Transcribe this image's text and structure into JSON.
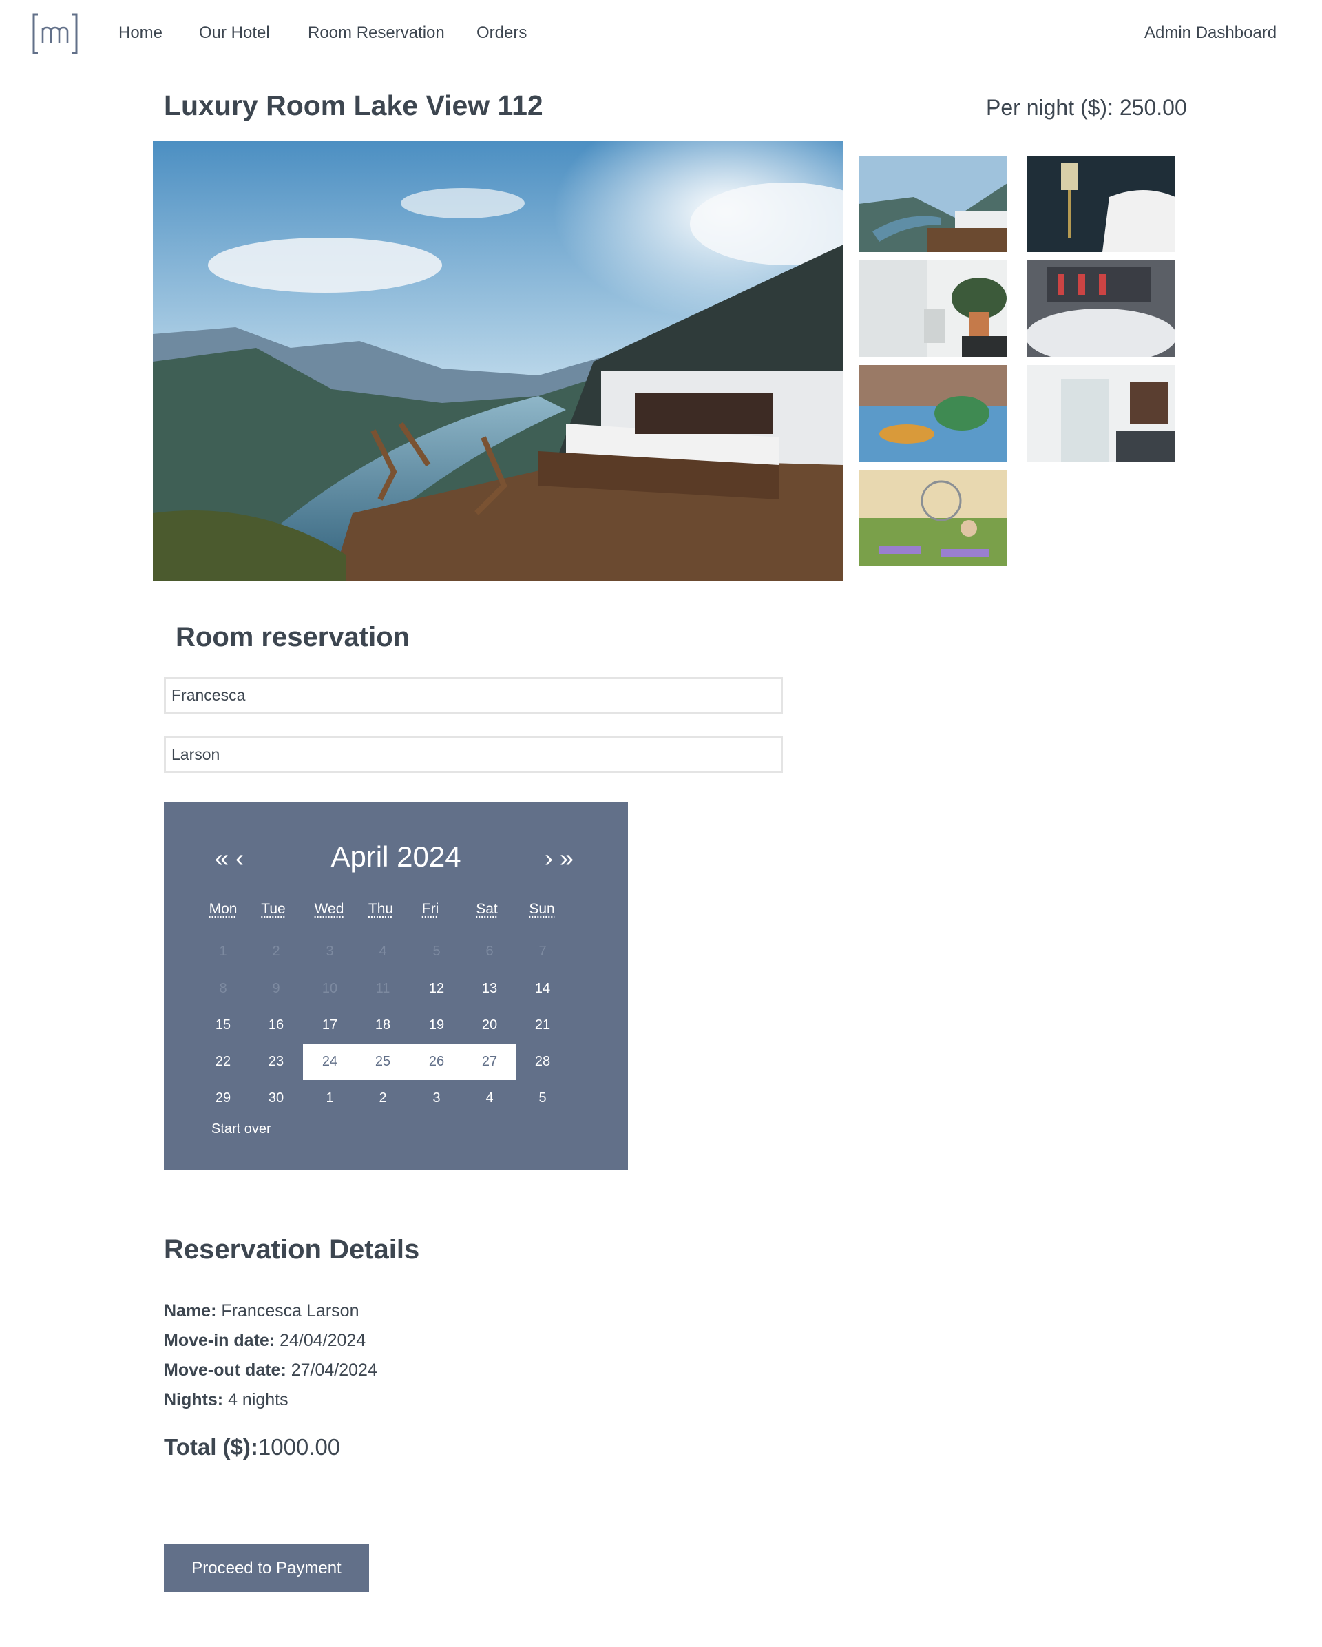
{
  "nav": {
    "logo_alt": "m",
    "home": "Home",
    "hotel": "Our Hotel",
    "reservation": "Room Reservation",
    "orders": "Orders",
    "admin": "Admin Dashboard"
  },
  "room": {
    "title": "Luxury Room Lake View 112",
    "price_label": "Per night ($):",
    "price_value": "250.00"
  },
  "form": {
    "heading": "Room reservation",
    "first_name": "Francesca",
    "last_name": "Larson"
  },
  "calendar": {
    "prev": "« ‹",
    "next": "› »",
    "month": "April 2024",
    "weekdays": [
      "Mon",
      "Tue",
      "Wed",
      "Thu",
      "Fri",
      "Sat",
      "Sun"
    ],
    "weeks": [
      [
        {
          "d": "1",
          "s": "muted"
        },
        {
          "d": "2",
          "s": "muted"
        },
        {
          "d": "3",
          "s": "muted"
        },
        {
          "d": "4",
          "s": "muted"
        },
        {
          "d": "5",
          "s": "muted"
        },
        {
          "d": "6",
          "s": "muted"
        },
        {
          "d": "7",
          "s": "muted"
        }
      ],
      [
        {
          "d": "8",
          "s": "muted"
        },
        {
          "d": "9",
          "s": "muted"
        },
        {
          "d": "10",
          "s": "muted"
        },
        {
          "d": "11",
          "s": "muted"
        },
        {
          "d": "12",
          "s": ""
        },
        {
          "d": "13",
          "s": ""
        },
        {
          "d": "14",
          "s": ""
        }
      ],
      [
        {
          "d": "15",
          "s": ""
        },
        {
          "d": "16",
          "s": ""
        },
        {
          "d": "17",
          "s": ""
        },
        {
          "d": "18",
          "s": ""
        },
        {
          "d": "19",
          "s": ""
        },
        {
          "d": "20",
          "s": ""
        },
        {
          "d": "21",
          "s": ""
        }
      ],
      [
        {
          "d": "22",
          "s": ""
        },
        {
          "d": "23",
          "s": ""
        },
        {
          "d": "24",
          "s": "sel"
        },
        {
          "d": "25",
          "s": "sel"
        },
        {
          "d": "26",
          "s": "sel"
        },
        {
          "d": "27",
          "s": "sel"
        },
        {
          "d": "28",
          "s": ""
        }
      ],
      [
        {
          "d": "29",
          "s": ""
        },
        {
          "d": "30",
          "s": ""
        },
        {
          "d": "1",
          "s": ""
        },
        {
          "d": "2",
          "s": ""
        },
        {
          "d": "3",
          "s": ""
        },
        {
          "d": "4",
          "s": ""
        },
        {
          "d": "5",
          "s": ""
        }
      ]
    ],
    "start_over": "Start over"
  },
  "details": {
    "heading": "Reservation Details",
    "name_label": "Name:",
    "name_value": "Francesca Larson",
    "movein_label": "Move-in date:",
    "movein_value": "24/04/2024",
    "moveout_label": "Move-out date:",
    "moveout_value": "27/04/2024",
    "nights_label": "Nights:",
    "nights_value": "4 nights",
    "total_label": "Total ($):",
    "total_value": "1000.00"
  },
  "actions": {
    "pay": "Proceed to Payment"
  },
  "colors": {
    "accent": "#627089",
    "text": "#3d4650",
    "muted_day": "#7d8aa0"
  }
}
